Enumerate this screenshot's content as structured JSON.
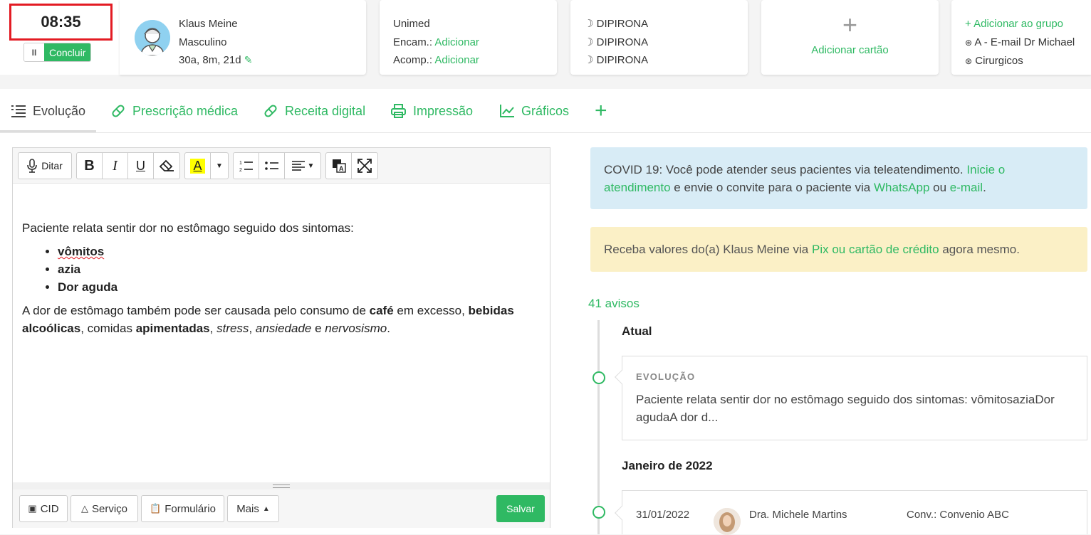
{
  "header": {
    "timer": "08:35",
    "pause_label": "II",
    "concluir_label": "Concluir",
    "patient": {
      "name": "Klaus Meine",
      "gender": "Masculino",
      "age": "30a, 8m, 21d"
    },
    "insurance": {
      "name": "Unimed",
      "encam_label": "Encam.:",
      "encam_link": "Adicionar",
      "acomp_label": "Acomp.:",
      "acomp_link": "Adicionar"
    },
    "medications": [
      "DIPIRONA",
      "DIPIRONA",
      "DIPIRONA"
    ],
    "add_card_label": "Adicionar cartão",
    "groups": {
      "add_label": "Adicionar ao grupo",
      "items": [
        "A - E-mail Dr Michael",
        "Cirurgicos"
      ]
    }
  },
  "tabs": [
    {
      "label": "Evolução",
      "icon": "list-icon"
    },
    {
      "label": "Prescrição médica",
      "icon": "pill-icon"
    },
    {
      "label": "Receita digital",
      "icon": "pill-icon"
    },
    {
      "label": "Impressão",
      "icon": "printer-icon"
    },
    {
      "label": "Gráficos",
      "icon": "chart-icon"
    }
  ],
  "editor": {
    "ditar_label": "Ditar",
    "intro": "Paciente relata sentir dor no estômago seguido dos sintomas:",
    "symptoms": [
      "vômitos",
      "azia",
      "Dor aguda"
    ],
    "para2": {
      "t1": "A dor de estômago também pode ser causada pelo consumo de ",
      "b1": "café",
      "t2": " em excesso, ",
      "b2": "bebidas alcoólicas",
      "t3": ", comidas ",
      "b3": "apimentadas",
      "t4": ", ",
      "i1": "stress",
      "t5": ", ",
      "i2": "ansiedade",
      "t6": " e ",
      "i3": "nervosismo",
      "t7": "."
    },
    "buttons": {
      "cid": "CID",
      "servico": "Serviço",
      "formulario": "Formulário",
      "mais": "Mais",
      "salvar": "Salvar"
    }
  },
  "alerts": {
    "covid": {
      "t1": "COVID 19: Você pode atender seus pacientes via teleatendimento. ",
      "link1": "Inicie o atendimento",
      "t2": " e envie o convite para o paciente via ",
      "link2": "WhatsApp",
      "t3": " ou ",
      "link3": "e-mail",
      "t4": "."
    },
    "payment": {
      "t1": "Receba valores do(a) Klaus Meine via ",
      "link": "Pix ou cartão de crédito",
      "t2": " agora mesmo."
    }
  },
  "timeline": {
    "count_label": "41 avisos",
    "section_current": "Atual",
    "evo_label": "EVOLUÇÃO",
    "evo_text": "Paciente relata sentir dor no estômago seguido dos sintomas: vômitosaziaDor agudaA dor d...",
    "section_month": "Janeiro de 2022",
    "entry": {
      "date": "31/01/2022",
      "doctor": "Dra. Michele Martins",
      "conv": "Conv.: Convenio ABC"
    }
  },
  "colors": {
    "accent": "#2fb963",
    "timer_border": "#e31b23",
    "alert_blue": "#d8ecf6",
    "alert_yellow": "#fbf0c6",
    "highlight": "#ffff00"
  }
}
